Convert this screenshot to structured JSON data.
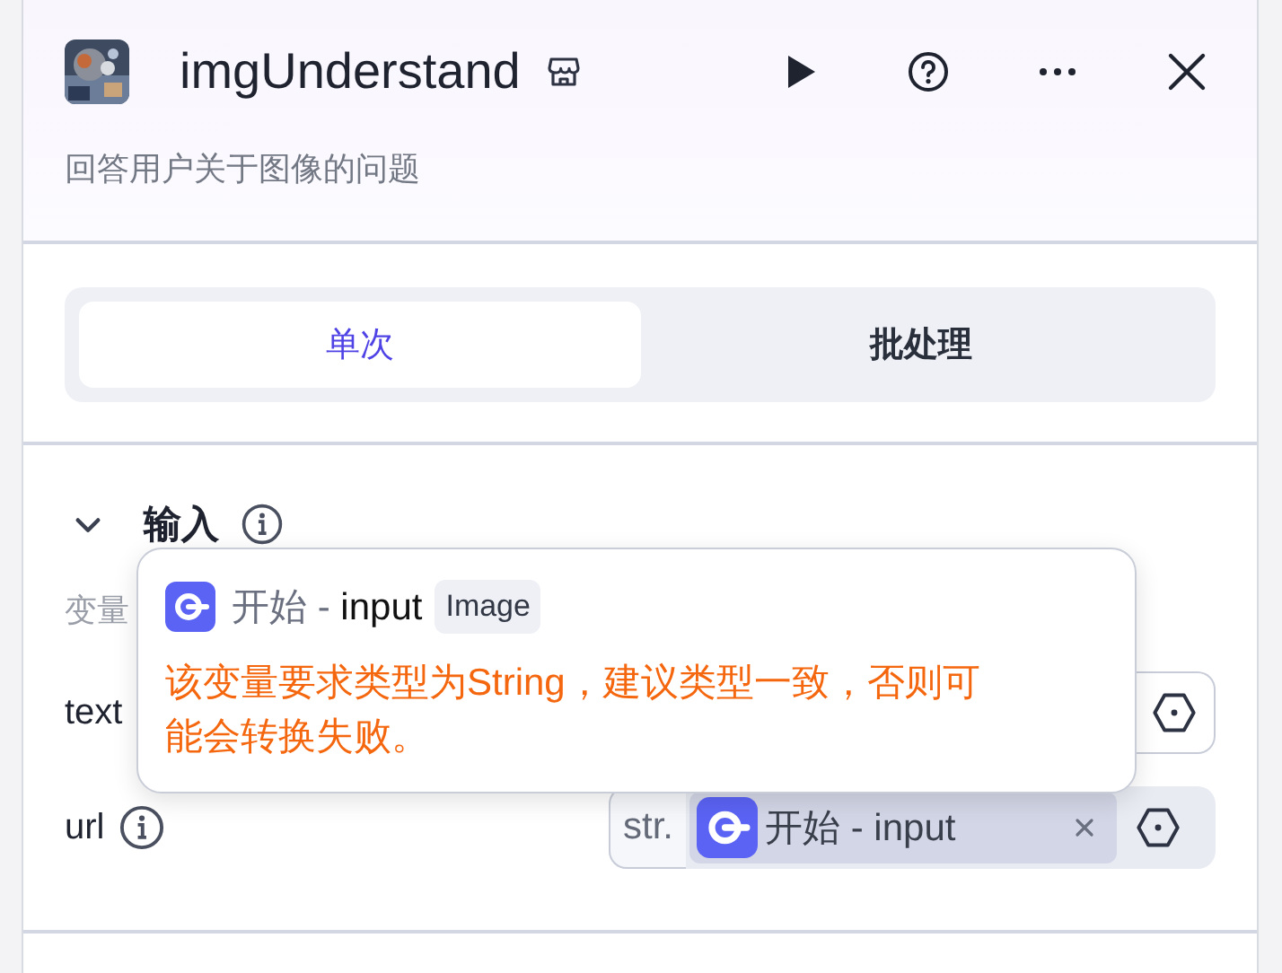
{
  "header": {
    "title": "imgUnderstand",
    "description": "回答用户关于图像的问题"
  },
  "tabs": [
    {
      "label": "单次",
      "selected": true
    },
    {
      "label": "批处理",
      "selected": false
    }
  ],
  "input_section": {
    "title": "输入",
    "expanded": true,
    "column_header": "变量",
    "rows": [
      {
        "name": "text",
        "info": false
      },
      {
        "name": "url",
        "info": true,
        "type": "str.",
        "variable": "开始 - input"
      }
    ]
  },
  "tooltip": {
    "variable": "开始 - **input**",
    "type_tag": "Image",
    "message": "该变量要求类型为String，建议类型一致，否则可能会转换失败。"
  }
}
